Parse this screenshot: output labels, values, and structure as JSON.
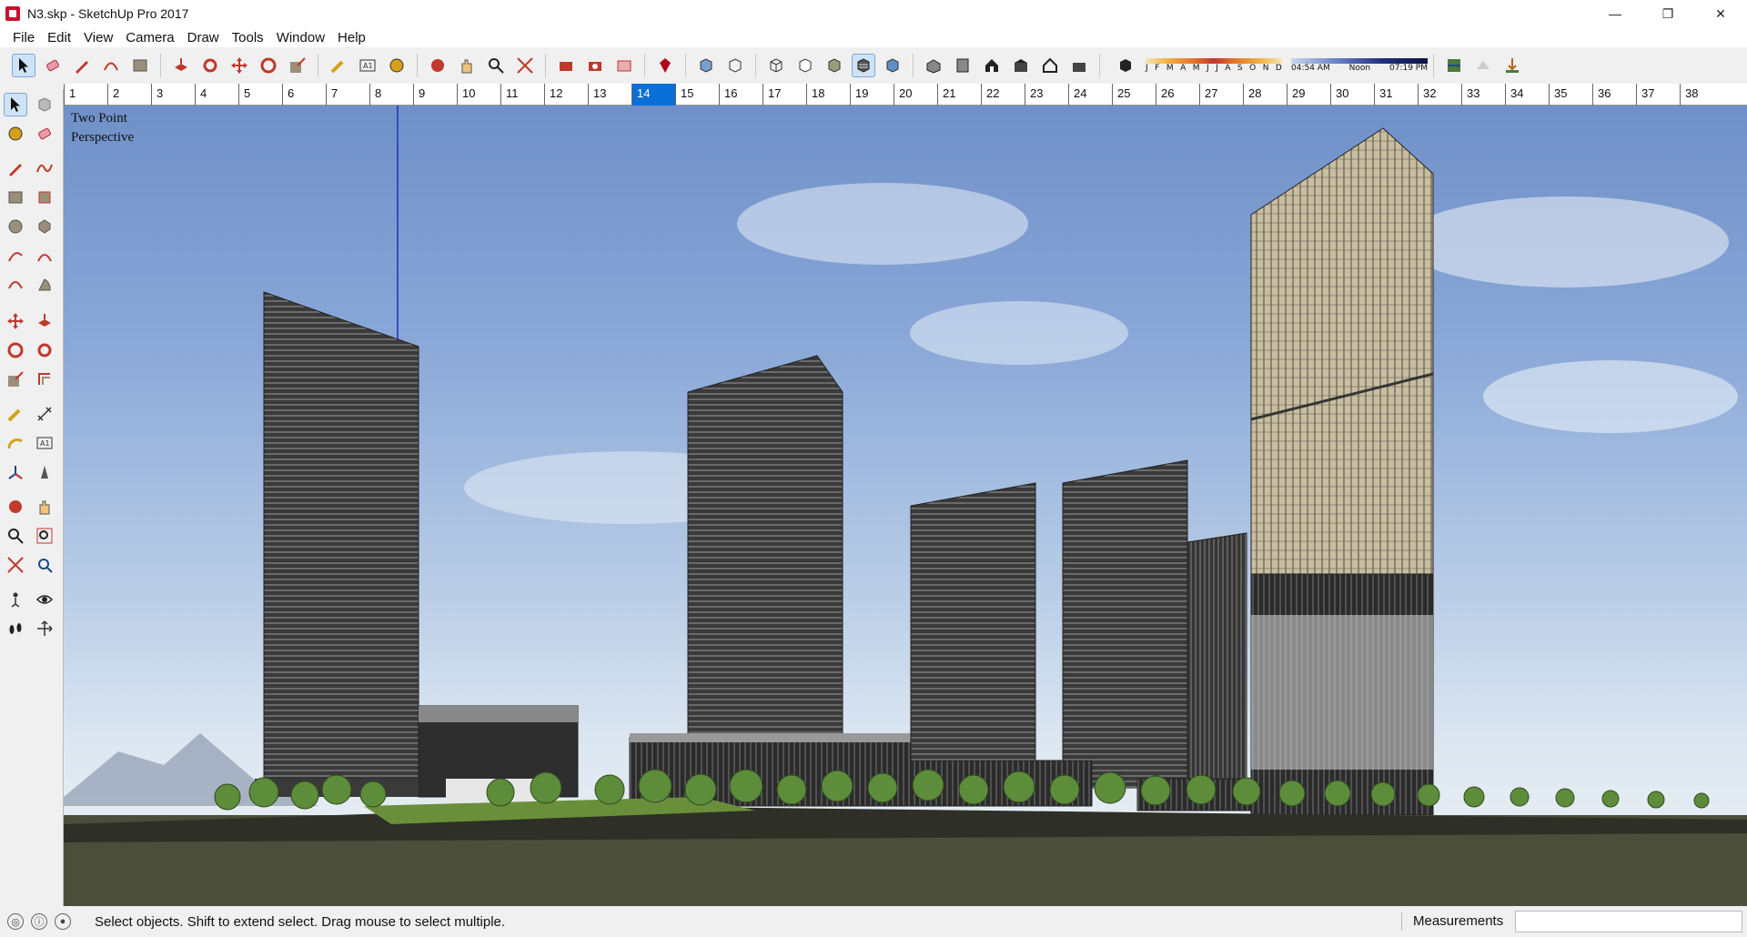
{
  "window": {
    "title": "N3.skp - SketchUp Pro 2017",
    "controls": {
      "minimize": "—",
      "restore": "❐",
      "close": "✕"
    }
  },
  "menu": [
    "File",
    "Edit",
    "View",
    "Camera",
    "Draw",
    "Tools",
    "Window",
    "Help"
  ],
  "shadow": {
    "months": [
      "J",
      "F",
      "M",
      "A",
      "M",
      "J",
      "J",
      "A",
      "S",
      "O",
      "N",
      "D"
    ],
    "time_start": "04:54 AM",
    "time_mid": "Noon",
    "time_end": "07:19 PM"
  },
  "ruler": {
    "current": "14",
    "numbers": [
      "1",
      "2",
      "3",
      "4",
      "5",
      "6",
      "7",
      "8",
      "9",
      "10",
      "11",
      "12",
      "13",
      "14",
      "15",
      "16",
      "17",
      "18",
      "19",
      "20",
      "21",
      "22",
      "23",
      "24",
      "25",
      "26",
      "27",
      "28",
      "29",
      "30",
      "31",
      "32",
      "33",
      "34",
      "35",
      "36",
      "37",
      "38"
    ]
  },
  "viewport": {
    "label_line1": "Two Point",
    "label_line2": "Perspective"
  },
  "status": {
    "message": "Select objects. Shift to extend select. Drag mouse to select multiple.",
    "measurements_label": "Measurements",
    "measurements_value": ""
  },
  "colors": {
    "accent": "#0a6fd6",
    "brand_red": "#c8102e",
    "sky_top": "#6f90c8",
    "ground": "#4a4e3a"
  }
}
